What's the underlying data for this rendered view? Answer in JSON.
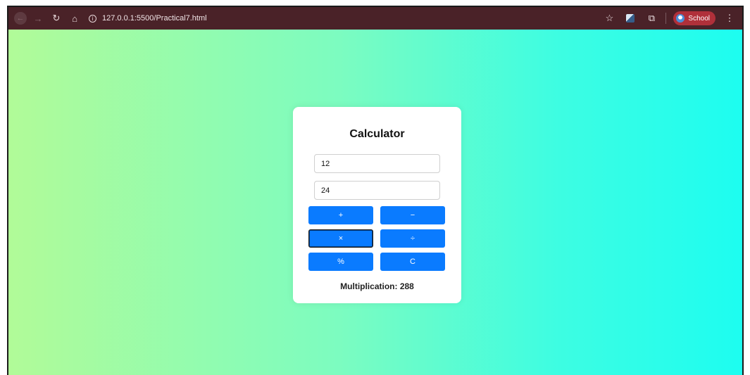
{
  "browser": {
    "url": "127.0.0.1:5500/Practical7.html",
    "back_icon": "←",
    "forward_icon": "→",
    "reload_icon": "↻",
    "home_icon": "⌂",
    "info_icon": "i",
    "star_icon": "☆",
    "extensions_icon": "⧉",
    "menu_icon": "⋮",
    "profile_label": "School"
  },
  "calculator": {
    "title": "Calculator",
    "input1_value": "12",
    "input2_value": "24",
    "buttons": {
      "add": "+",
      "subtract": "−",
      "multiply": "×",
      "divide": "÷",
      "modulus": "%",
      "clear": "C"
    },
    "result": "Multiplication: 288"
  },
  "colors": {
    "gradient_start": "#b1fb98",
    "gradient_end": "#1dfdf0",
    "button_blue": "#0a7bff",
    "browser_bar": "#4a2228",
    "profile_chip": "#b0303a"
  }
}
